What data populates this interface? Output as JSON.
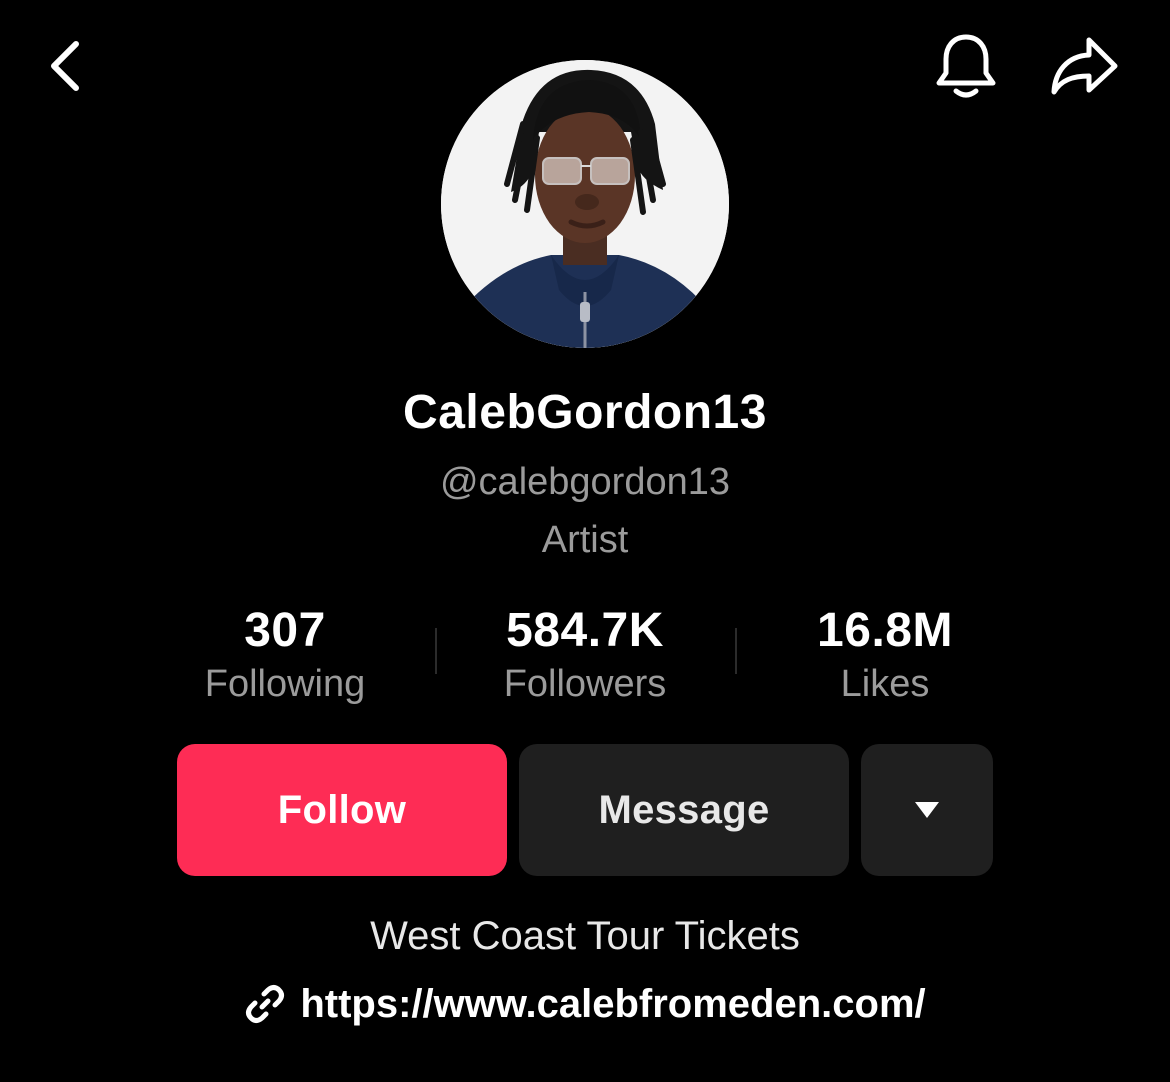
{
  "header": {
    "back_icon": "chevron-left-icon",
    "notification_icon": "bell-icon",
    "share_icon": "share-arrow-icon"
  },
  "profile": {
    "display_name": "CalebGordon13",
    "handle": "@calebgordon13",
    "category": "Artist"
  },
  "stats": [
    {
      "value": "307",
      "label": "Following"
    },
    {
      "value": "584.7K",
      "label": "Followers"
    },
    {
      "value": "16.8M",
      "label": "Likes"
    }
  ],
  "actions": {
    "follow_label": "Follow",
    "message_label": "Message",
    "more_icon": "caret-down-icon"
  },
  "bio": {
    "text": "West Coast Tour Tickets",
    "link_icon": "link-icon",
    "url": "https://www.calebfromeden.com/"
  },
  "colors": {
    "background": "#000000",
    "accent": "#fe2c55",
    "secondary_button": "#1f1f1f",
    "muted_text": "#9b9b9b"
  }
}
